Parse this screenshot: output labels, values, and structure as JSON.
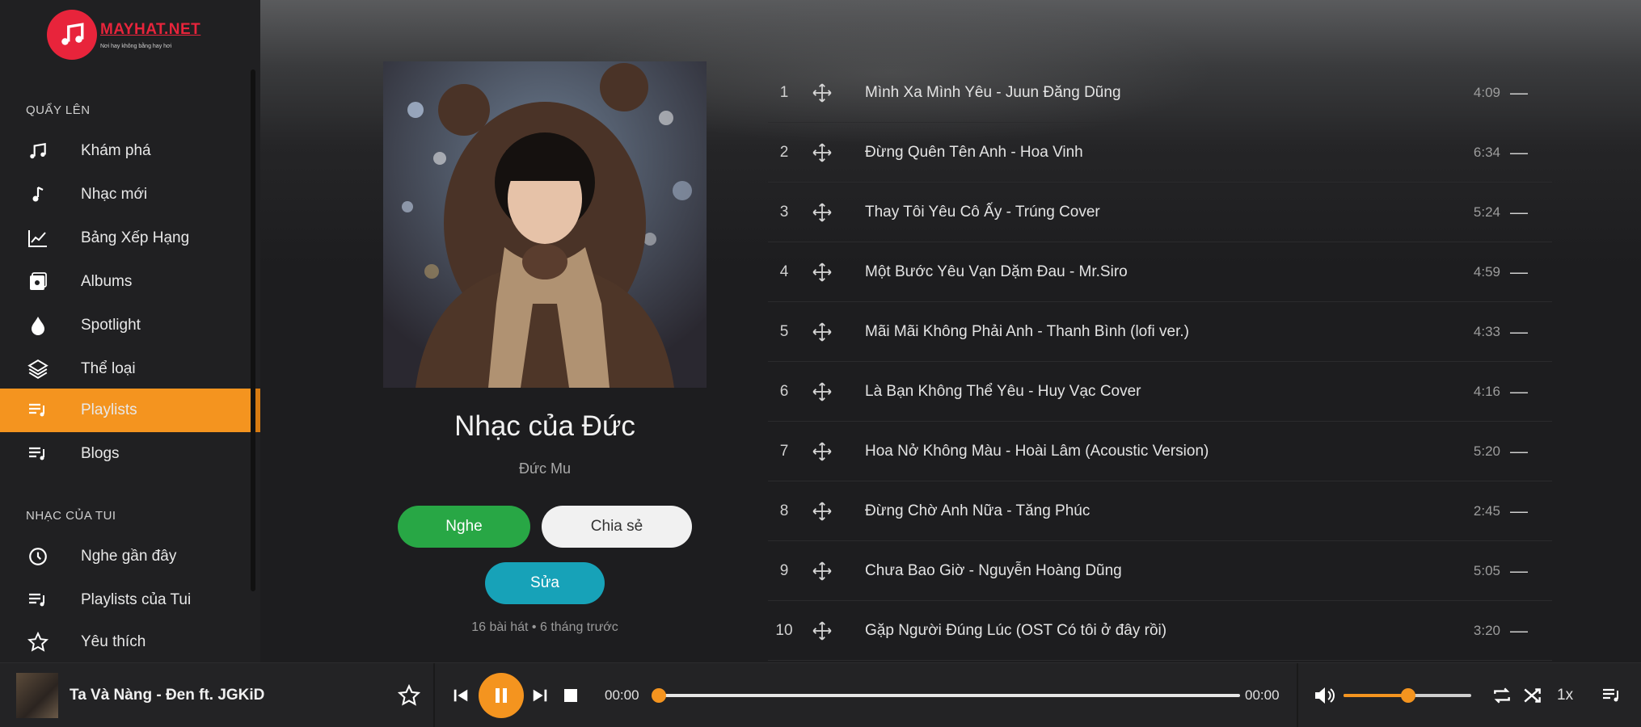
{
  "brand": {
    "name": "MAYHAT.NET",
    "tagline": "Nơi hay không bằng hay hơi"
  },
  "sidebar": {
    "section1_title": "QUẨY LÊN",
    "section2_title": "NHẠC CỦA TUI",
    "items": [
      {
        "label": "Khám phá",
        "icon": "music-notes-icon"
      },
      {
        "label": "Nhạc mới",
        "icon": "music-note-icon"
      },
      {
        "label": "Bảng Xếp Hạng",
        "icon": "chart-icon"
      },
      {
        "label": "Albums",
        "icon": "album-icon"
      },
      {
        "label": "Spotlight",
        "icon": "drop-icon"
      },
      {
        "label": "Thể loại",
        "icon": "layers-icon"
      },
      {
        "label": "Playlists",
        "icon": "playlist-icon",
        "active": true
      },
      {
        "label": "Blogs",
        "icon": "blog-icon"
      }
    ],
    "my_items": [
      {
        "label": "Nghe gần đây",
        "icon": "history-icon"
      },
      {
        "label": "Playlists của Tui",
        "icon": "my-playlist-icon"
      },
      {
        "label": "Yêu thích",
        "icon": "star-icon"
      }
    ]
  },
  "playlist": {
    "title": "Nhạc của Đức",
    "owner": "Đức Mu",
    "listen_label": "Nghe",
    "share_label": "Chia sẻ",
    "edit_label": "Sửa",
    "meta": "16 bài hát • 6 tháng trước"
  },
  "tracks": [
    {
      "num": "1",
      "title": "Mình Xa Mình Yêu - Juun Đăng Dũng",
      "duration": "4:09"
    },
    {
      "num": "2",
      "title": "Đừng Quên Tên Anh - Hoa Vinh",
      "duration": "6:34"
    },
    {
      "num": "3",
      "title": "Thay Tôi Yêu Cô Ấy - Trúng Cover",
      "duration": "5:24"
    },
    {
      "num": "4",
      "title": "Một Bước Yêu Vạn Dặm Đau - Mr.Siro",
      "duration": "4:59"
    },
    {
      "num": "5",
      "title": "Mãi Mãi Không Phải Anh - Thanh Bình (lofi ver.)",
      "duration": "4:33"
    },
    {
      "num": "6",
      "title": "Là Bạn Không Thể Yêu - Huy Vạc Cover",
      "duration": "4:16"
    },
    {
      "num": "7",
      "title": "Hoa Nở Không Màu - Hoài Lâm (Acoustic Version)",
      "duration": "5:20"
    },
    {
      "num": "8",
      "title": "Đừng Chờ Anh Nữa - Tăng Phúc",
      "duration": "2:45"
    },
    {
      "num": "9",
      "title": "Chưa Bao Giờ - Nguyễn Hoàng Dũng",
      "duration": "5:05"
    },
    {
      "num": "10",
      "title": "Gặp Người Đúng Lúc (OST Có tôi ở đây rồi)",
      "duration": "3:20"
    }
  ],
  "player": {
    "now_playing": "Ta Và Nàng - Đen ft. JGKiD",
    "current_time": "00:00",
    "total_time": "00:00",
    "progress": 0,
    "volume": 0.5,
    "speed": "1x"
  },
  "colors": {
    "accent": "#f4941f",
    "brand": "#e8243b",
    "listen": "#28a745",
    "edit": "#17a2b8"
  }
}
